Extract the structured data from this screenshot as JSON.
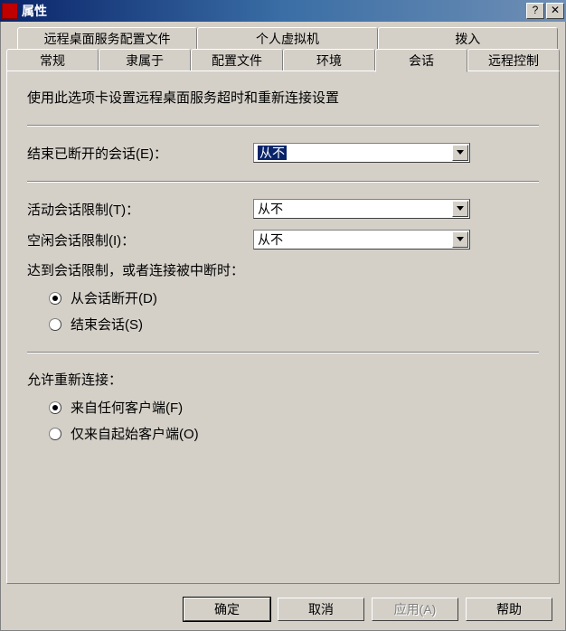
{
  "title": "属性",
  "tabs_top": {
    "rds_profile": "远程桌面服务配置文件",
    "personal_vm": "个人虚拟机",
    "dial_in": "拨入"
  },
  "tabs_bottom": {
    "general": "常规",
    "member_of": "隶属于",
    "profile": "配置文件",
    "environment": "环境",
    "sessions": "会话",
    "remote_control": "远程控制"
  },
  "panel": {
    "description": "使用此选项卡设置远程桌面服务超时和重新连接设置",
    "end_disconnected_label": "结束已断开的会话(E)：",
    "active_limit_label": "活动会话限制(T)：",
    "idle_limit_label": "空闲会话限制(I)：",
    "limit_reached_label": "达到会话限制，或者连接被中断时：",
    "opt_disconnect": "从会话断开(D)",
    "opt_end": "结束会话(S)",
    "reconnect_label": "允许重新连接：",
    "opt_any_client": "来自任何客户端(F)",
    "opt_orig_client": "仅来自起始客户端(O)"
  },
  "dropdowns": {
    "end_disconnected": "从不",
    "active_limit": "从不",
    "idle_limit": "从不"
  },
  "buttons": {
    "ok": "确定",
    "cancel": "取消",
    "apply": "应用(A)",
    "help": "帮助"
  }
}
